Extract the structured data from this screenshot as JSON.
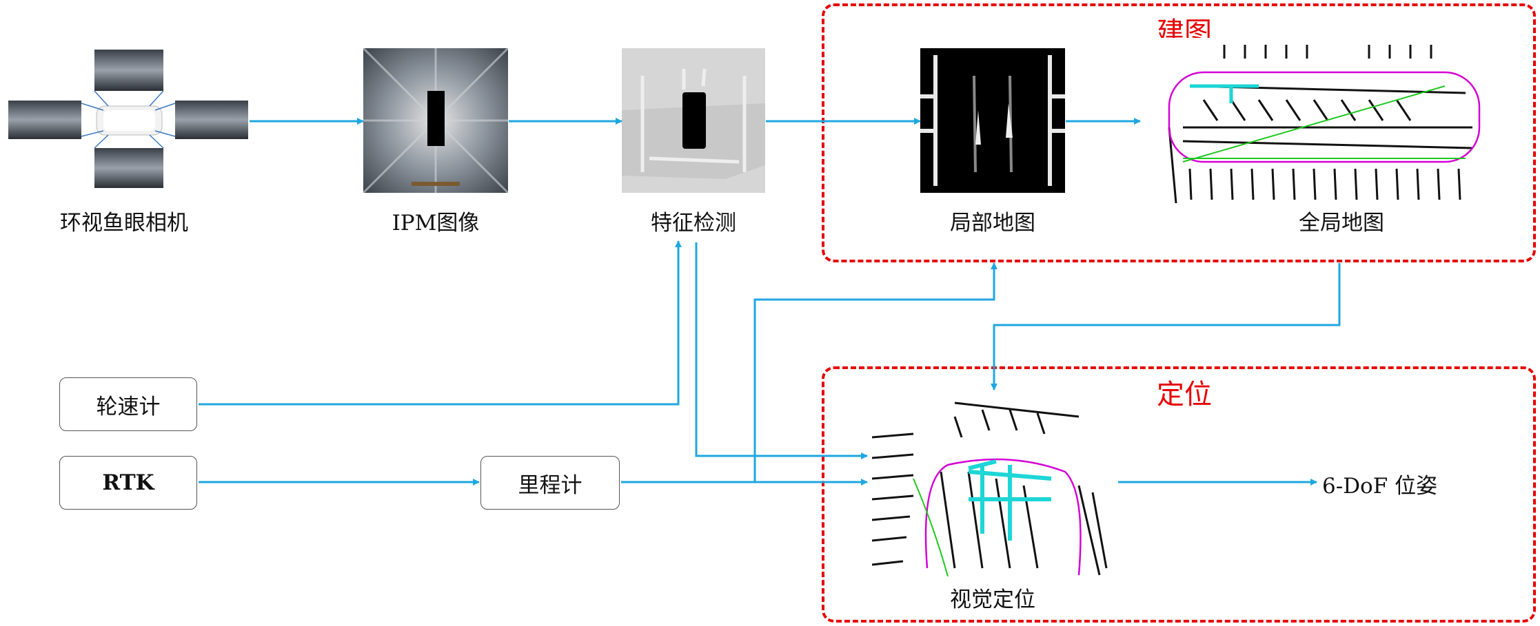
{
  "nodes": {
    "fisheye": "环视鱼眼相机",
    "ipm": "IPM图像",
    "feature": "特征检测",
    "local_map": "局部地图",
    "global_map": "全局地图",
    "wheel": "轮速计",
    "rtk": "RTK",
    "odometer": "里程计",
    "visual_loc": "视觉定位",
    "pose": "6-DoF 位姿"
  },
  "regions": {
    "mapping": "建图",
    "localization": "定位"
  },
  "colors": {
    "arrow": "#1ea7e1",
    "region_border": "#e60000",
    "region_title": "#e60000"
  }
}
